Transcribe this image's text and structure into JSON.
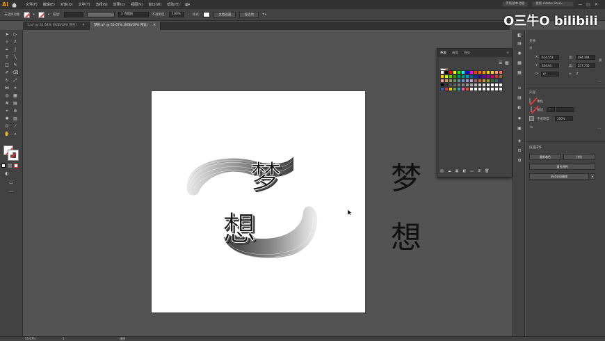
{
  "app": {
    "logo": "Ai"
  },
  "menubar": {
    "items": [
      "文件(F)",
      "编辑(E)",
      "对象(O)",
      "文字(T)",
      "选择(S)",
      "效果(C)",
      "视图(V)",
      "窗口(W)",
      "帮助(H)"
    ],
    "workspace": "传统基本功能",
    "search_placeholder": "搜索 Adobe Stock"
  },
  "controlbar": {
    "selection_label": "未选择对象",
    "stroke_label": "描边:",
    "brush_label": "3 点圆形",
    "opacity_label": "不透明度:",
    "opacity_value": "100%",
    "style_label": "样式:",
    "doc_setup_button": "文档设置",
    "preferences_button": "首选项"
  },
  "tabs": [
    {
      "label": "1.ai* @ 31.64% (RGB/GPU 预览)",
      "active": false
    },
    {
      "label": "梦想.ai* @ 55.67% (RGB/GPU 预览)",
      "active": true
    }
  ],
  "artwork": {
    "char_top": "梦",
    "char_bottom": "想",
    "side_text_top": "梦",
    "side_text_bottom": "想"
  },
  "swatches_panel": {
    "tabs": [
      "色板",
      "画笔",
      "符号"
    ],
    "colors": [
      "#ffffff",
      "#000000",
      "#ff0000",
      "#ffff00",
      "#00ff00",
      "#00ffff",
      "#0000ff",
      "#ff00ff",
      "#ff3300",
      "#ff6600",
      "#ff9900",
      "#ffcc00",
      "#ffcc33",
      "#ff9966",
      "#ff6666",
      "#ffcc00",
      "#ccff00",
      "#66cc00",
      "#339900",
      "#009966",
      "#009999",
      "#0099cc",
      "#006699",
      "#003399",
      "#330099",
      "#660099",
      "#990099",
      "#cc0066",
      "#cc3333",
      "#996633",
      "#ff9999",
      "#cc9966",
      "#999966",
      "#669966",
      "#669999",
      "#6699cc",
      "#9999cc",
      "#cc99cc",
      "#996666",
      "#cc6633",
      "#cc9933",
      "#999933",
      "#336633",
      "#336666",
      "#333366",
      "#000000",
      "#333333",
      "#555555",
      "#666666",
      "#777777",
      "#888888",
      "#999999",
      "#aaaaaa",
      "#bbbbbb",
      "#cccccc",
      "#dddddd",
      "#eeeeee",
      "#ffffff",
      "#ffffff",
      "#ffffff",
      "#3366cc",
      "#cc3333",
      "#ffcc00",
      "#66aa33",
      "#33aacc",
      "#ff6699",
      "#e74c3c",
      "#ffffff",
      "#ffffff",
      "#ffffff",
      "#ffffff",
      "#ffffff",
      "#ffffff",
      "#ffffff",
      "#ffffff"
    ]
  },
  "properties": {
    "transform_label": "变换",
    "x_label": "X:",
    "x_value": "614.553",
    "y_label": "Y:",
    "y_value": "634.94",
    "w_label": "宽:",
    "w_value": "494.394",
    "h_label": "高:",
    "h_value": "277.735",
    "angle_value": "0°",
    "appearance_label": "外观",
    "fill_label": "填色",
    "stroke_label": "描边",
    "opacity_label": "不透明度",
    "opacity_value": "100%",
    "quick_actions_label": "快速操作",
    "btn_recolor": "重新着色",
    "btn_arrange": "排列",
    "btn_align": "重合选择",
    "btn_edit": "启动全局编辑"
  },
  "status": {
    "zoom": "55.67%",
    "page": "1",
    "mode": "选择"
  },
  "watermark": "O三牛O bilibili"
}
